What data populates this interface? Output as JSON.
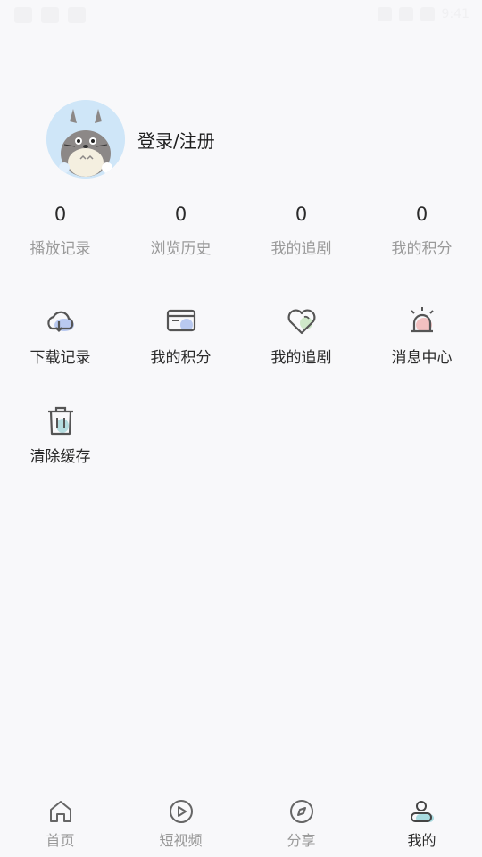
{
  "status_bar": {
    "time": "9:41"
  },
  "profile": {
    "login_label": "登录/注册"
  },
  "stats": [
    {
      "value": "0",
      "label": "播放记录"
    },
    {
      "value": "0",
      "label": "浏览历史"
    },
    {
      "value": "0",
      "label": "我的追剧"
    },
    {
      "value": "0",
      "label": "我的积分"
    }
  ],
  "menu": [
    {
      "label": "下载记录",
      "icon": "cloud-download-icon"
    },
    {
      "label": "我的积分",
      "icon": "card-icon"
    },
    {
      "label": "我的追剧",
      "icon": "heart-icon"
    },
    {
      "label": "消息中心",
      "icon": "alarm-icon"
    },
    {
      "label": "清除缓存",
      "icon": "trash-icon"
    }
  ],
  "tabs": [
    {
      "label": "首页",
      "icon": "home-icon"
    },
    {
      "label": "短视频",
      "icon": "play-icon"
    },
    {
      "label": "分享",
      "icon": "compass-icon"
    },
    {
      "label": "我的",
      "icon": "user-icon"
    }
  ],
  "colors": {
    "background": "#f8f8fa",
    "accent_blue": "#b9c9f0",
    "accent_green": "#cfe8c9",
    "accent_red": "#f2c0c0"
  }
}
